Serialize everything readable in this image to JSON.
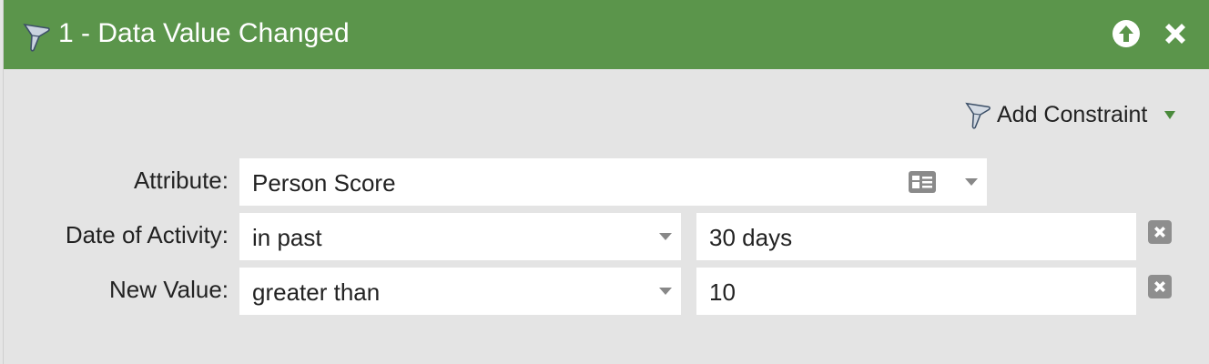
{
  "header": {
    "title": "1 - Data Value Changed",
    "background": "#5b954b",
    "icons": [
      "filter-icon",
      "move-up-icon",
      "close-icon"
    ]
  },
  "toolbar": {
    "add_constraint_label": "Add Constraint",
    "icons": [
      "filter-icon",
      "dropdown-caret-icon"
    ],
    "caret_color": "#4a8a3c"
  },
  "rows": [
    {
      "label": "Attribute:",
      "operator": "Person Score",
      "icons": [
        "contact-card-icon",
        "chevron-down-icon"
      ]
    },
    {
      "label": "Date of Activity:",
      "operator": "in past",
      "value": "30 days",
      "icons": [
        "chevron-down-icon",
        "remove-icon"
      ]
    },
    {
      "label": "New Value:",
      "operator": "greater than",
      "value": "10",
      "icons": [
        "chevron-down-icon",
        "remove-icon"
      ]
    }
  ]
}
